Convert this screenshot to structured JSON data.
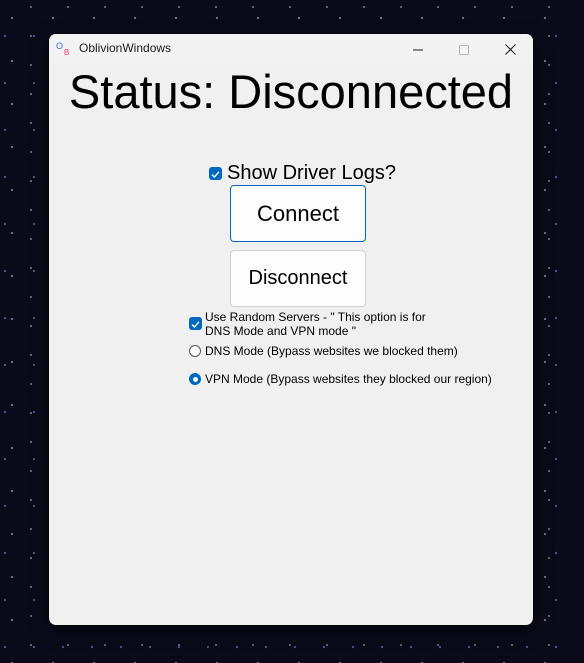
{
  "window": {
    "title": "OblivionWindows",
    "icon_text": "OB"
  },
  "status": {
    "text": "Status: Disconnected"
  },
  "options": {
    "show_driver_logs_label": "Show Driver Logs?",
    "show_driver_logs_checked": true,
    "random_servers_label_line1": "Use Random Servers - \" This option is for",
    "random_servers_label_line2": "DNS Mode and VPN mode \"",
    "random_servers_checked": true,
    "dns_mode_label": "DNS Mode (Bypass websites we blocked them)",
    "vpn_mode_label": "VPN Mode (Bypass websites they blocked our region)",
    "selected_mode": "VPN Mode"
  },
  "buttons": {
    "connect_label": "Connect",
    "disconnect_label": "Disconnect"
  },
  "colors": {
    "accent": "#0067c0",
    "window_bg": "#f0f0f0"
  },
  "icons": [
    "app-logo-icon",
    "minimize-icon",
    "maximize-icon",
    "close-icon",
    "checkmark-icon"
  ]
}
